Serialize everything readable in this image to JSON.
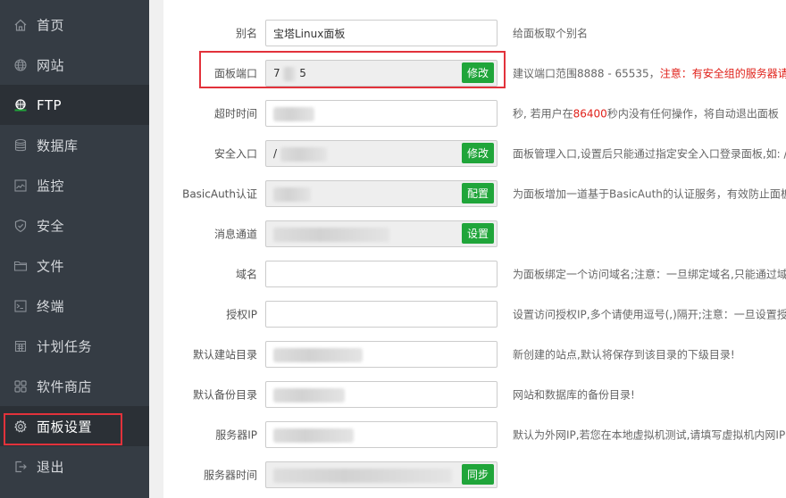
{
  "sidebar": {
    "items": [
      {
        "label": "首页",
        "icon": "home-icon"
      },
      {
        "label": "网站",
        "icon": "globe-icon"
      },
      {
        "label": "FTP",
        "icon": "ftp-icon",
        "active": true
      },
      {
        "label": "数据库",
        "icon": "database-icon"
      },
      {
        "label": "监控",
        "icon": "monitor-icon"
      },
      {
        "label": "安全",
        "icon": "shield-icon"
      },
      {
        "label": "文件",
        "icon": "folder-icon"
      },
      {
        "label": "终端",
        "icon": "terminal-icon"
      },
      {
        "label": "计划任务",
        "icon": "calendar-icon"
      },
      {
        "label": "软件商店",
        "icon": "grid-icon"
      },
      {
        "label": "面板设置",
        "icon": "gear-icon",
        "highlighted": true
      },
      {
        "label": "退出",
        "icon": "logout-icon"
      }
    ]
  },
  "settings": {
    "alias": {
      "label": "别名",
      "value": "宝塔Linux面板",
      "hint": "给面板取个别名"
    },
    "port": {
      "label": "面板端口",
      "value_prefix": "7",
      "value_suffix": "5",
      "button": "修改",
      "hint": "建议端口范围8888 - 65535，",
      "hint_warning": "注意：有安全组的服务器请提"
    },
    "timeout": {
      "label": "超时时间",
      "hint_pre": "秒, 若用户在",
      "hint_num": "86400",
      "hint_post": "秒内没有任何操作，将自动退出面板"
    },
    "security_entry": {
      "label": "安全入口",
      "value_prefix": "/",
      "button": "修改",
      "hint": "面板管理入口,设置后只能通过指定安全入口登录面板,如: /"
    },
    "basic_auth": {
      "label": "BasicAuth认证",
      "button": "配置",
      "hint": "为面板增加一道基于BasicAuth的认证服务，有效防止面板"
    },
    "message_channel": {
      "label": "消息通道",
      "button": "设置"
    },
    "domain": {
      "label": "域名",
      "hint": "为面板绑定一个访问域名;注意：一旦绑定域名,只能通过域"
    },
    "auth_ip": {
      "label": "授权IP",
      "hint": "设置访问授权IP,多个请使用逗号(,)隔开;注意：一旦设置授"
    },
    "site_dir": {
      "label": "默认建站目录",
      "hint": "新创建的站点,默认将保存到该目录的下级目录!"
    },
    "backup_dir": {
      "label": "默认备份目录",
      "hint": "网站和数据库的备份目录!"
    },
    "server_ip": {
      "label": "服务器IP",
      "hint": "默认为外网IP,若您在本地虚拟机测试,请填写虚拟机内网IP"
    },
    "server_time": {
      "label": "服务器时间",
      "button": "同步"
    }
  },
  "colors": {
    "sidebar_bg": "#353c44",
    "sidebar_active": "#2b3036",
    "accent_green": "#20a53a",
    "highlight_red": "#e2323b",
    "warning_red": "#e0211a"
  }
}
